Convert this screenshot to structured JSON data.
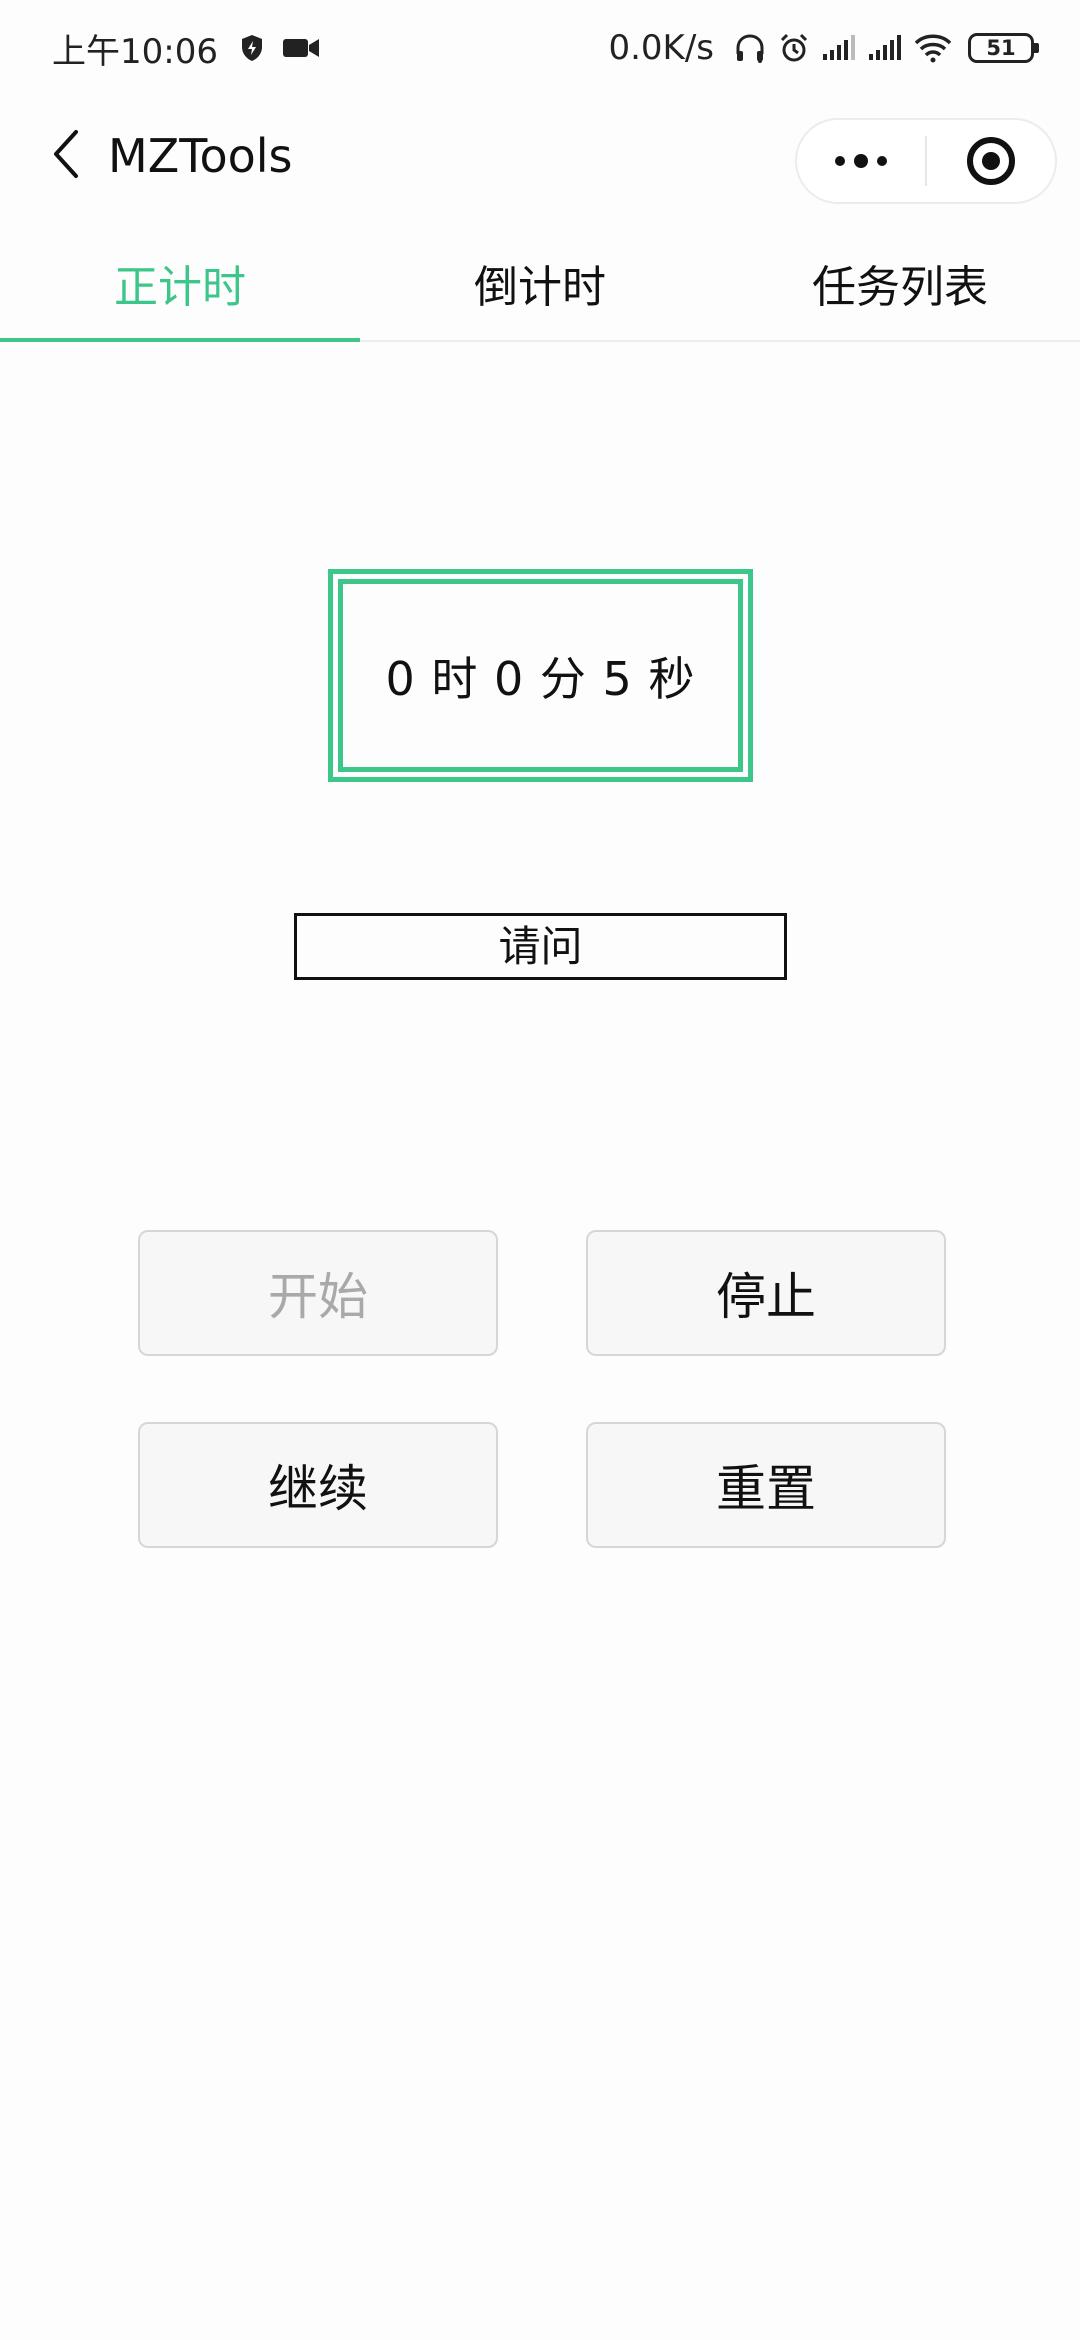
{
  "status_bar": {
    "time": "上午10:06",
    "net_speed": "0.0K/s",
    "battery_level": "51",
    "icons": [
      "shield-bolt-icon",
      "video-camera-icon",
      "headphones-icon",
      "alarm-icon",
      "signal-icon",
      "signal-icon",
      "wifi-icon",
      "battery-icon"
    ]
  },
  "nav": {
    "title": "MZTools",
    "back_icon": "chevron-left-icon",
    "menu_icon": "more-dots-icon",
    "close_icon": "target-circle-icon"
  },
  "tabs": [
    {
      "label": "正计时",
      "active": true
    },
    {
      "label": "倒计时",
      "active": false
    },
    {
      "label": "任务列表",
      "active": false
    }
  ],
  "timer": {
    "display": "0 时 0 分 5 秒"
  },
  "input": {
    "placeholder": "请问"
  },
  "buttons": {
    "start": {
      "label": "开始",
      "disabled": true
    },
    "stop": {
      "label": "停止",
      "disabled": false
    },
    "resume": {
      "label": "继续",
      "disabled": false
    },
    "reset": {
      "label": "重置",
      "disabled": false
    }
  },
  "colors": {
    "accent": "#3cc68a",
    "text": "#111111",
    "disabled_text": "#a9a9a9",
    "button_bg": "#f6f7f6",
    "button_border": "#d6d6d6",
    "background": "#fdfdfd"
  }
}
